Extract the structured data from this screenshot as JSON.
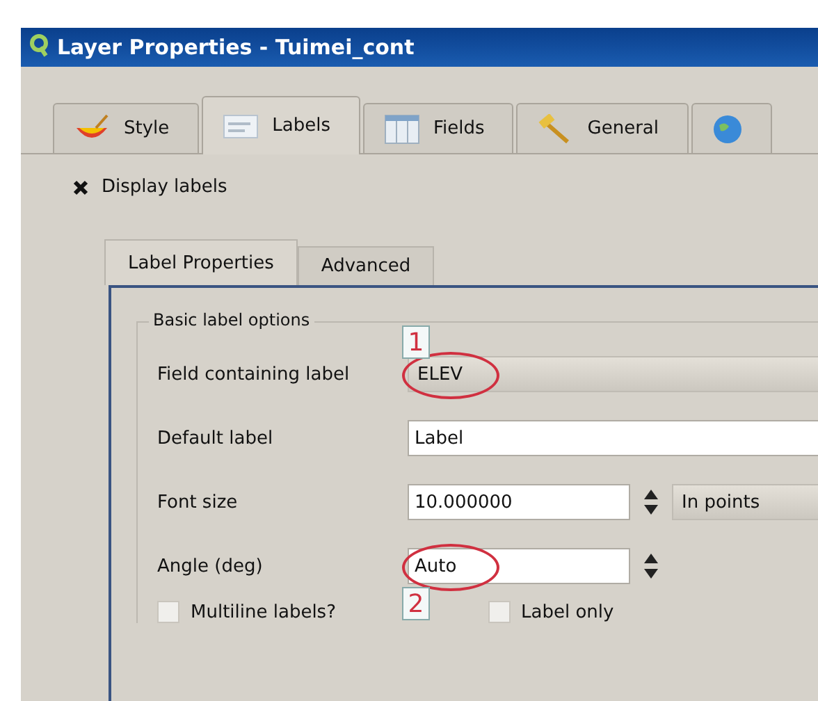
{
  "window": {
    "title": "Layer Properties - Tuimei_cont"
  },
  "tabs": [
    {
      "label": "Style",
      "selected": false
    },
    {
      "label": "Labels",
      "selected": true
    },
    {
      "label": "Fields",
      "selected": false
    },
    {
      "label": "General",
      "selected": false
    },
    {
      "selected": false
    }
  ],
  "display_labels": {
    "label": "Display labels",
    "checked": true
  },
  "sub_tabs": [
    {
      "label": "Label Properties",
      "selected": true
    },
    {
      "label": "Advanced",
      "selected": false
    }
  ],
  "group": {
    "title": "Basic label options"
  },
  "rows": [
    {
      "kind": "combo",
      "label": "Field containing label",
      "value": "ELEV",
      "annotation": "1"
    },
    {
      "kind": "text",
      "label": "Default label",
      "value": "Label"
    },
    {
      "kind": "spin",
      "label": "Font size",
      "value": "10.000000",
      "unit": "In points"
    },
    {
      "kind": "spin",
      "label": "Angle (deg)",
      "value": "Auto",
      "annotation": "2"
    }
  ],
  "options": [
    {
      "label": "Multiline labels?",
      "checked": false
    },
    {
      "label": "Label only",
      "checked": false
    }
  ]
}
